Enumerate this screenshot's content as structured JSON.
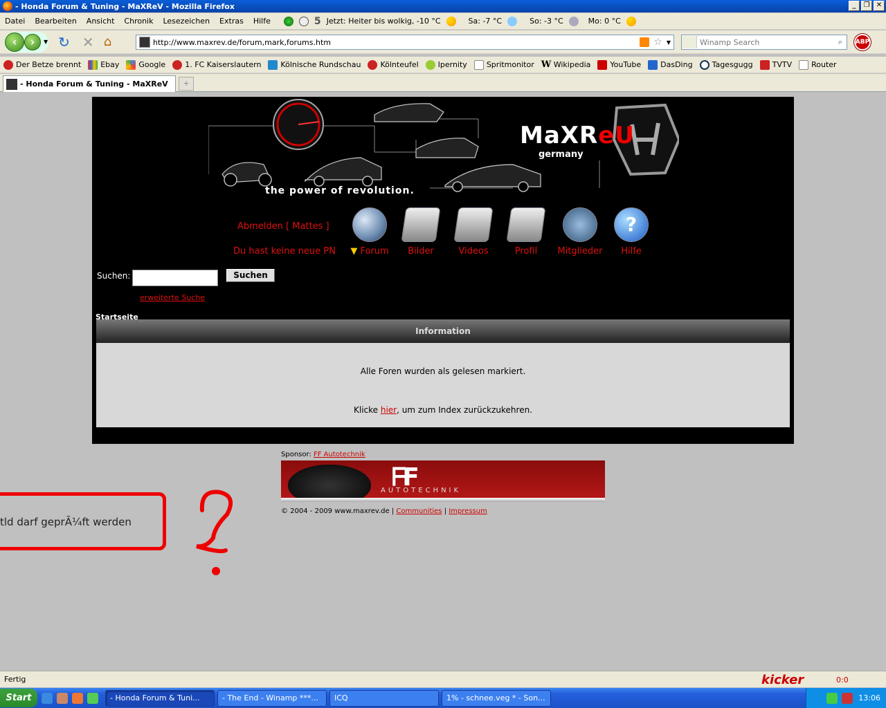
{
  "window": {
    "title": "- Honda Forum & Tuning - MaXReV - Mozilla Firefox"
  },
  "menu": {
    "items": [
      "Datei",
      "Bearbeiten",
      "Ansicht",
      "Chronik",
      "Lesezeichen",
      "Extras",
      "Hilfe"
    ],
    "weather_count": "5",
    "weather_now": "Jetzt: Heiter bis wolkig, -10 °C",
    "weather_sa": "Sa: -7 °C",
    "weather_so": "So: -3 °C",
    "weather_mo": "Mo: 0 °C"
  },
  "nav": {
    "url": "http://www.maxrev.de/forum,mark,forums.htm",
    "search_placeholder": "Winamp Search",
    "abp": "ABP"
  },
  "bookmarks": [
    "Der Betze brennt",
    "Ebay",
    "Google",
    "1. FC Kaiserslautern",
    "Kölnische Rundschau",
    "Kölnteufel",
    "Ipernity",
    "Spritmonitor",
    "Wikipedia",
    "YouTube",
    "DasDing",
    "Tagesgugg",
    "TVTV",
    "Router"
  ],
  "tab": {
    "title": "- Honda Forum & Tuning - MaXReV"
  },
  "page": {
    "logo_main": "MaXR",
    "logo_accent": "eU",
    "logo_sub": "germany",
    "tagline": "the power of revolution.",
    "logout": "Abmelden [ Mattes ]",
    "pn": "Du hast keine neue PN",
    "nav_items": [
      "Forum",
      "Bilder",
      "Videos",
      "Profil",
      "Mitglieder",
      "Hilfe"
    ],
    "search_label": "Suchen:",
    "search_button": "Suchen",
    "extended_search": "erweiterte Suche",
    "breadcrumb": "Startseite",
    "info_title": "Information",
    "info_msg": "Alle Foren wurden als gelesen markiert.",
    "back_pre": "Klicke ",
    "back_link": "hier",
    "back_post": ", um zum Index zurückzukehren.",
    "sponsor_label": "Sponsor: ",
    "sponsor_link": "FF Autotechnik",
    "sponsor_banner_text": "AUTOTECHNIK",
    "copyright": "© 2004 - 2009 www.maxrev.de | ",
    "footer_communities": "Communities",
    "footer_sep": " | ",
    "footer_impressum": "Impressum",
    "annotation_text": "tld darf geprÃ¼ft werden"
  },
  "status": {
    "text": "Fertig",
    "kicker": "kicker",
    "score": "0:0"
  },
  "taskbar": {
    "start": "Start",
    "tasks": [
      "- Honda Forum & Tuni...",
      "- The End - Winamp ***...",
      "ICQ",
      "1% - schnee.veg * - Son..."
    ],
    "clock": "13:06"
  }
}
